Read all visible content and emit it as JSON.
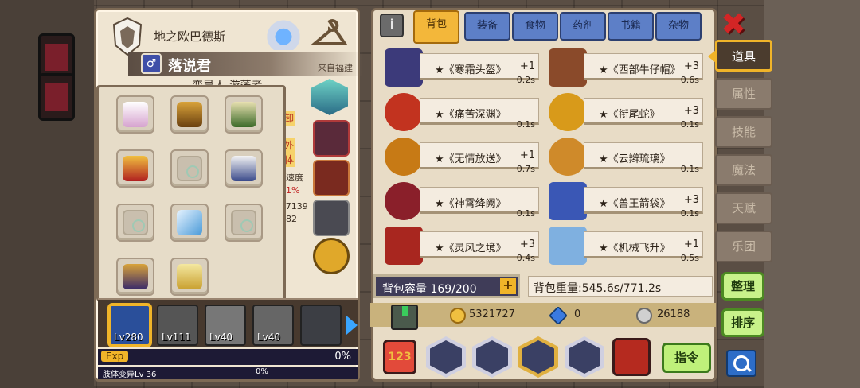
{
  "character": {
    "title": "地之欧巴德斯",
    "name": "落说君",
    "gender_icon": "male-icon",
    "origin": "来自福建",
    "sub_title_partial": "变异人 游荡者",
    "side_tags": [
      "卸",
      "外",
      "体"
    ],
    "stats_partial": [
      "速度",
      "1%",
      "/7139",
      "82"
    ]
  },
  "party": [
    {
      "level": "Lv280",
      "active": true
    },
    {
      "level": "Lv111",
      "active": false
    },
    {
      "level": "Lv40",
      "active": false
    },
    {
      "level": "Lv40",
      "active": false
    },
    {
      "level": "",
      "active": false
    }
  ],
  "exp": {
    "label": "Exp",
    "percent": "0%",
    "sub_label": "肢体变异Lv 36",
    "sub_percent": "0%"
  },
  "tabs": [
    "背包",
    "装备",
    "食物",
    "药剂",
    "书籍",
    "杂物"
  ],
  "active_tab": "背包",
  "inventory": [
    {
      "name": "★《寒霜头盔》",
      "qty": "+1",
      "weight": "0.2s",
      "color": "#3c3a7a"
    },
    {
      "name": "★《西部牛仔帽》",
      "qty": "+3",
      "weight": "0.6s",
      "color": "#8a4a2a"
    },
    {
      "name": "★《痛苦深渊》",
      "qty": "",
      "weight": "0.1s",
      "color": "#c2331f"
    },
    {
      "name": "★《衔尾蛇》",
      "qty": "+3",
      "weight": "0.1s",
      "color": "#d89a1a"
    },
    {
      "name": "★《无情放送》",
      "qty": "+1",
      "weight": "0.7s",
      "color": "#c77a15"
    },
    {
      "name": "★《云辫琉璃》",
      "qty": "",
      "weight": "0.1s",
      "color": "#cf8a2a"
    },
    {
      "name": "★《神霄绛阙》",
      "qty": "",
      "weight": "0.1s",
      "color": "#8a1f2a"
    },
    {
      "name": "★《兽王箭袋》",
      "qty": "+3",
      "weight": "0.1s",
      "color": "#3a57b5"
    },
    {
      "name": "★《灵风之境》",
      "qty": "+3",
      "weight": "0.4s",
      "color": "#a8261f"
    },
    {
      "name": "★《机械飞升》",
      "qty": "+1",
      "weight": "0.5s",
      "color": "#7fb0e0"
    }
  ],
  "capacity": "背包容量 169/200",
  "weight": "背包重量:545.6s/771.2s",
  "currency": {
    "gold": "5321727",
    "gem": "0",
    "silver": "26188"
  },
  "command_button": "指令",
  "side_menu": [
    "道具",
    "属性",
    "技能",
    "魔法",
    "天赋",
    "乐团"
  ],
  "side_menu_active": "道具",
  "sort_buttons": [
    "整理",
    "排序"
  ],
  "icons": {
    "info": "info-icon",
    "close": "close-icon",
    "search": "search-icon",
    "plus": "plus-icon"
  }
}
